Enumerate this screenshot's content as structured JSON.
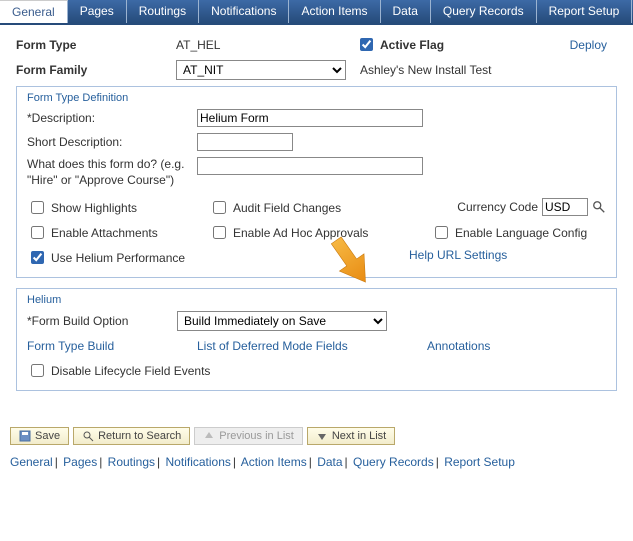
{
  "tabs": [
    "General",
    "Pages",
    "Routings",
    "Notifications",
    "Action Items",
    "Data",
    "Query Records",
    "Report Setup"
  ],
  "activeTab": "General",
  "header": {
    "formTypeLabel": "Form Type",
    "formTypeValue": "AT_HEL",
    "activeFlagLabel": "Active Flag",
    "deployLabel": "Deploy",
    "formFamilyLabel": "Form Family",
    "formFamilyValue": "AT_NIT",
    "formFamilyDesc": "Ashley's New Install Test"
  },
  "typedef": {
    "title": "Form Type Definition",
    "descriptionLabel": "*Description:",
    "descriptionValue": "Helium Form",
    "shortDescLabel": "Short Description:",
    "shortDescValue": "",
    "whatDoesLabel": "What does this form do? (e.g. \"Hire\" or \"Approve Course\")",
    "whatDoesValue": "",
    "cbShowHighlights": "Show Highlights",
    "cbAuditFieldChanges": "Audit Field Changes",
    "currencyCodeLabel": "Currency Code",
    "currencyCodeValue": "USD",
    "cbEnableAttachments": "Enable Attachments",
    "cbEnableAdHoc": "Enable Ad Hoc Approvals",
    "cbEnableLangConfig": "Enable Language Config",
    "cbUseHeliumPerf": "Use Helium Performance",
    "helpUrlLink": "Help URL Settings"
  },
  "helium": {
    "title": "Helium",
    "formBuildLabel": "*Form Build Option",
    "formBuildValue": "Build Immediately on Save",
    "linkFormTypeBuild": "Form Type Build",
    "linkDeferredFields": "List of Deferred Mode Fields",
    "linkAnnotations": "Annotations",
    "cbDisableLifecycle": "Disable Lifecycle Field Events"
  },
  "toolbar": {
    "save": "Save",
    "returnSearch": "Return to Search",
    "prevInList": "Previous in List",
    "nextInList": "Next in List"
  },
  "bottomLinks": [
    "General",
    "Pages",
    "Routings",
    "Notifications",
    "Action Items",
    "Data",
    "Query Records",
    "Report Setup"
  ]
}
